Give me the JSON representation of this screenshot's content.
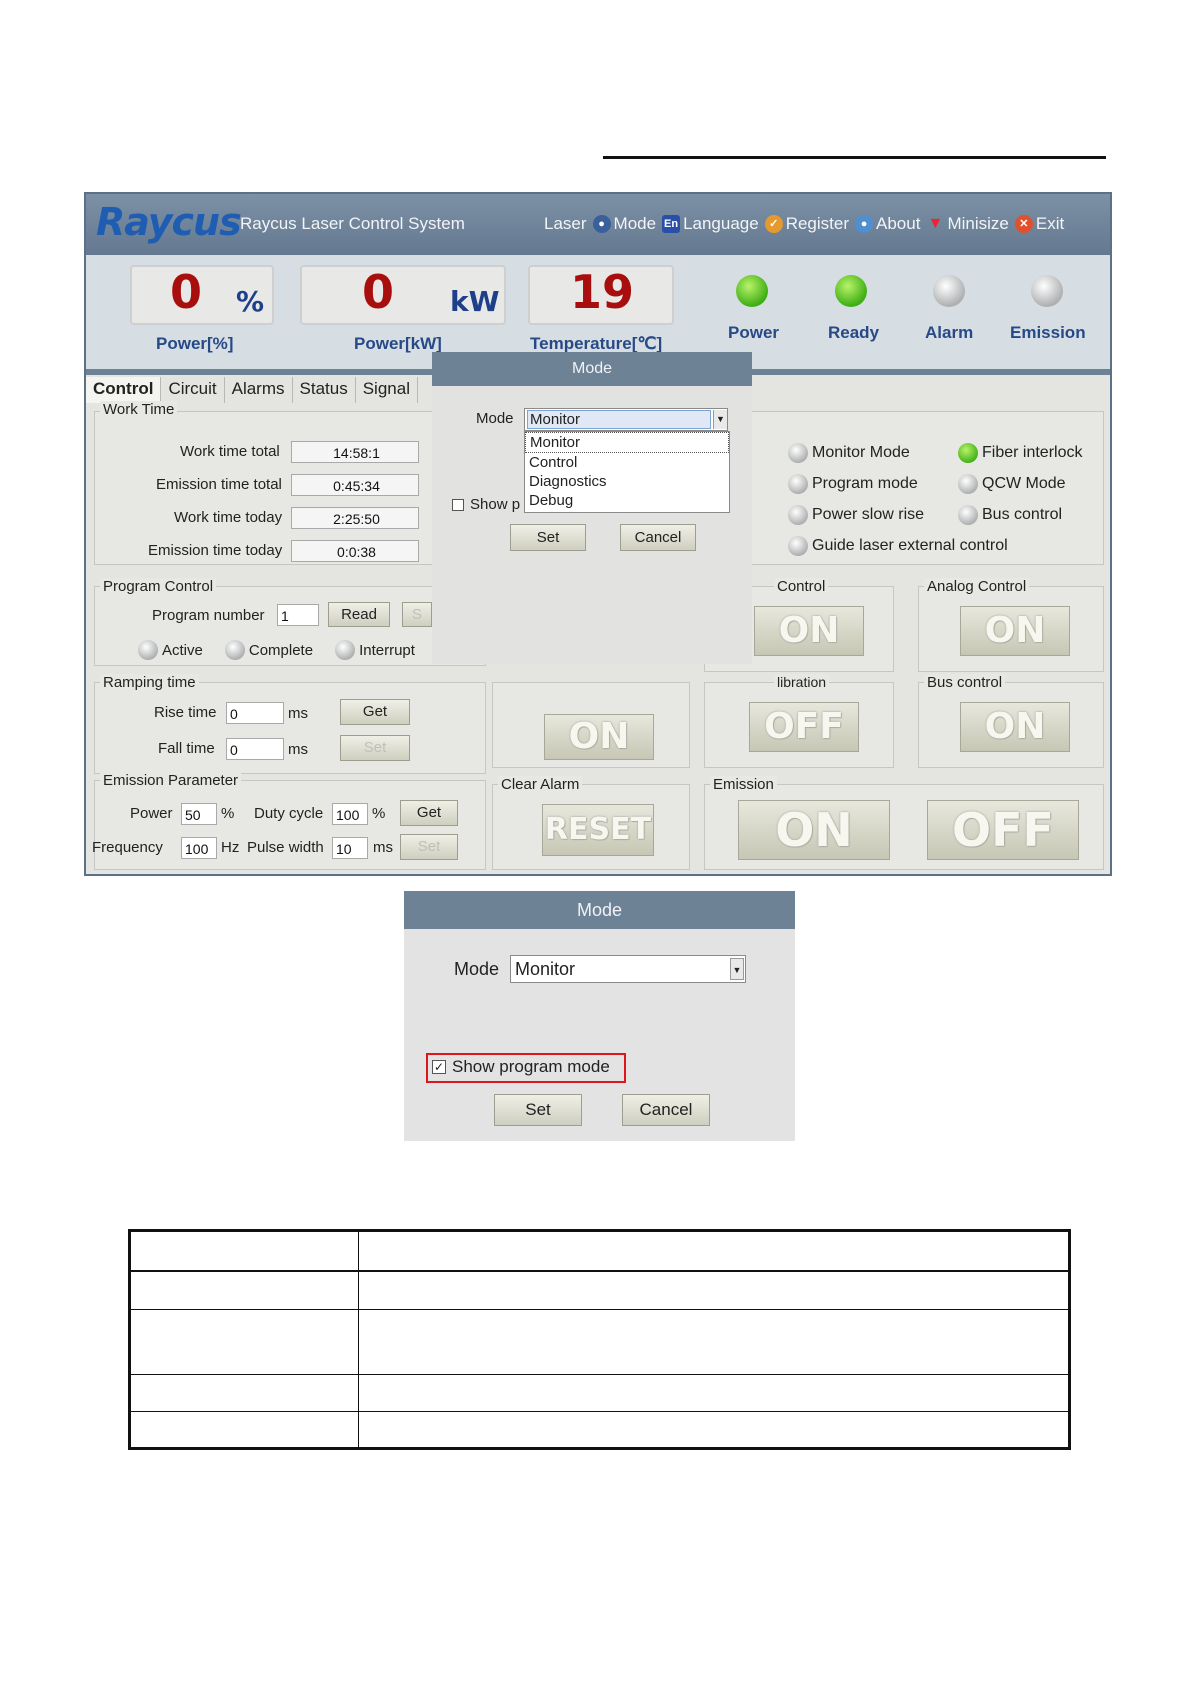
{
  "header": {
    "app_title": "Raycus Laser Control System",
    "logo_text": "Raycus"
  },
  "menu": [
    {
      "label": "Laser",
      "icon": ""
    },
    {
      "label": "Mode",
      "icon": "users-icon"
    },
    {
      "label": "Language",
      "icon": "language-icon"
    },
    {
      "label": "Register",
      "icon": "register-icon"
    },
    {
      "label": "About",
      "icon": "about-icon"
    },
    {
      "label": "Minisize",
      "icon": "minimize-icon"
    },
    {
      "label": "Exit",
      "icon": "exit-icon"
    }
  ],
  "status_panel": {
    "power_pct": {
      "value": "0",
      "unit": "%",
      "label": "Power[%]"
    },
    "power_kw": {
      "value": "0",
      "unit": "kW",
      "label": "Power[kW]"
    },
    "temperature": {
      "value": "19",
      "label": "Temperature[℃]"
    },
    "indicators": [
      {
        "label": "Power",
        "state": "green"
      },
      {
        "label": "Ready",
        "state": "green"
      },
      {
        "label": "Alarm",
        "state": "gray"
      },
      {
        "label": "Emission",
        "state": "gray"
      }
    ]
  },
  "tabs": [
    "Control",
    "Circuit",
    "Alarms",
    "Status",
    "Signal"
  ],
  "work_time": {
    "title": "Work Time",
    "rows": [
      {
        "label": "Work time total",
        "value": "14:58:1"
      },
      {
        "label": "Emission time total",
        "value": "0:45:34"
      },
      {
        "label": "Work time today",
        "value": "2:25:50"
      },
      {
        "label": "Emission time today",
        "value": "0:0:38"
      }
    ]
  },
  "program_control": {
    "title": "Program Control",
    "number_label": "Program number",
    "number_value": "1",
    "read_label": "Read",
    "set_label_partial": "S",
    "states": [
      "Active",
      "Complete",
      "Interrupt"
    ]
  },
  "ramping": {
    "title": "Ramping time",
    "rise_label": "Rise time",
    "rise_value": "0",
    "rise_unit": "ms",
    "fall_label": "Fall time",
    "fall_value": "0",
    "fall_unit": "ms",
    "get_label": "Get",
    "set_label": "Set"
  },
  "emission_param": {
    "title": "Emission Parameter",
    "power_label": "Power",
    "power_value": "50",
    "power_unit": "%",
    "duty_label": "Duty cycle",
    "duty_value": "100",
    "duty_unit": "%",
    "freq_label": "Frequency",
    "freq_value": "100",
    "freq_unit": "Hz",
    "pulse_label": "Pulse width",
    "pulse_value": "10",
    "pulse_unit": "ms",
    "get_label": "Get",
    "set_label": "Set"
  },
  "mode_status": [
    {
      "label": "Monitor Mode",
      "state": "gray"
    },
    {
      "label": "Fiber interlock",
      "state": "green"
    },
    {
      "label": "Program mode",
      "state": "gray"
    },
    {
      "label": "QCW Mode",
      "state": "gray"
    },
    {
      "label": "Power slow rise",
      "state": "gray"
    },
    {
      "label": "Bus control",
      "state": "gray"
    },
    {
      "label": "Guide laser external control",
      "state": "gray"
    }
  ],
  "control_groups": {
    "partial_control_title": "Control",
    "analog_title": "Analog Control",
    "calibration_title": "libration",
    "bus_title": "Bus control",
    "clear_alarm_title": "Clear Alarm",
    "emission_title": "Emission",
    "on": "ON",
    "off": "OFF",
    "reset": "RESET"
  },
  "mode_dialog": {
    "title": "Mode",
    "mode_label": "Mode",
    "selected": "Monitor",
    "options": [
      "Monitor",
      "Control",
      "Diagnostics",
      "Debug"
    ],
    "checkbox_partial": "Show p",
    "set_label": "Set",
    "cancel_label": "Cancel"
  },
  "mode_dialog_2": {
    "title": "Mode",
    "mode_label": "Mode",
    "selected": "Monitor",
    "checkbox_label": "Show program mode",
    "checked": true,
    "set_label": "Set",
    "cancel_label": "Cancel"
  },
  "colors": {
    "accent": "#6e8296",
    "digits": "#a80e0e",
    "label_blue": "#274a86",
    "highlight": "#e0141b"
  }
}
